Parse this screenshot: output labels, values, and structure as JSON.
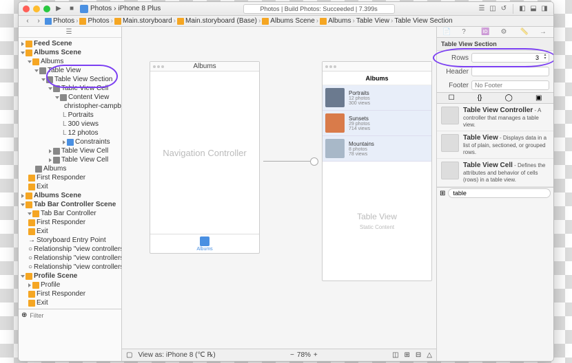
{
  "toolbar": {
    "scheme_app": "Photos",
    "scheme_device": "iPhone 8 Plus",
    "status": "Photos | Build Photos: Succeeded | 7.399s"
  },
  "pathbar": [
    "Photos",
    "Photos",
    "Main.storyboard",
    "Main.storyboard (Base)",
    "Albums Scene",
    "Albums",
    "Table View",
    "Table View Section"
  ],
  "outline": {
    "feed_scene": "Feed Scene",
    "albums_scene": "Albums Scene",
    "albums": "Albums",
    "table_view": "Table View",
    "table_view_section": "Table View Section",
    "table_view_cell": "Table View Cell",
    "content_view": "Content View",
    "christopher": "christopher-campb...",
    "portraits": "Portraits",
    "views300": "300 views",
    "photos12": "12 photos",
    "constraints": "Constraints",
    "table_view_cell2": "Table View Cell",
    "table_view_cell3": "Table View Cell",
    "albums2": "Albums",
    "first_responder": "First Responder",
    "exit": "Exit",
    "albums_scene2": "Albums Scene",
    "tab_bar_scene": "Tab Bar Controller Scene",
    "tab_bar_controller": "Tab Bar Controller",
    "storyboard_entry": "Storyboard Entry Point",
    "rel1": "Relationship \"view controllers\" to \"F...",
    "rel2": "Relationship \"view controllers\" to \"...",
    "rel3": "Relationship \"view controllers\" to \"...",
    "profile_scene": "Profile Scene",
    "profile": "Profile"
  },
  "filter_placeholder": "Filter",
  "canvas": {
    "nav_title": "Albums",
    "nav_controller": "Navigation Controller",
    "tab_label": "Albums",
    "albums_header": "Albums",
    "rows": [
      {
        "title": "Portraits",
        "sub1": "12 photos",
        "sub2": "300 views",
        "color": "#6b7a8f"
      },
      {
        "title": "Sunsets",
        "sub1": "29 photos",
        "sub2": "714 views",
        "color": "#d97b4a"
      },
      {
        "title": "Mountains",
        "sub1": "8 photos",
        "sub2": "78 views",
        "color": "#a8b8c8"
      }
    ],
    "table_view": "Table View",
    "static_content": "Static Content",
    "view_as": "View as: iPhone 8 (℃ ℞)",
    "zoom": "78%"
  },
  "inspector": {
    "section_title": "Table View Section",
    "rows_label": "Rows",
    "rows_value": "3",
    "header_label": "Header",
    "footer_label": "Footer",
    "footer_placeholder": "No Footer"
  },
  "library": {
    "items": [
      {
        "title": "Table View Controller",
        "desc": " - A controller that manages a table view."
      },
      {
        "title": "Table View",
        "desc": " - Displays data in a list of plain, sectioned, or grouped rows."
      },
      {
        "title": "Table View Cell",
        "desc": " - Defines the attributes and behavior of cells (rows) in a table view."
      }
    ],
    "filter_value": "table"
  }
}
